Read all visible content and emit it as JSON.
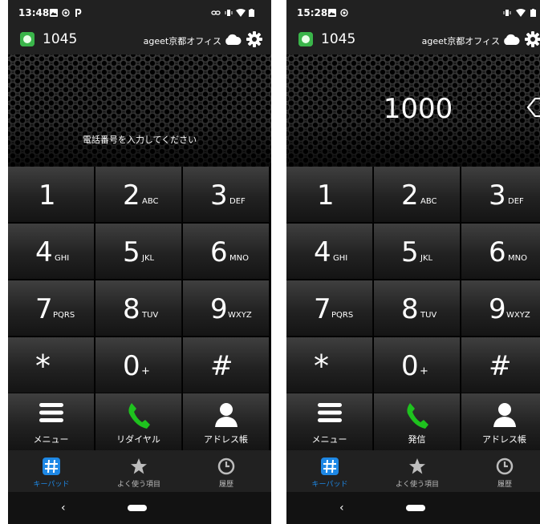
{
  "colors": {
    "status_online": "#3ab54a",
    "tab_active": "#1e88e5",
    "call_green": "#1ec21e",
    "background": "#000000"
  },
  "screens": [
    {
      "status_time": "13:48",
      "extension": "1045",
      "office": "ageet京都オフィス",
      "display_hint": "電話番号を入力してください",
      "entered_number": "",
      "keys": [
        {
          "digit": "1",
          "letters": ""
        },
        {
          "digit": "2",
          "letters": "ABC"
        },
        {
          "digit": "3",
          "letters": "DEF"
        },
        {
          "digit": "4",
          "letters": "GHI"
        },
        {
          "digit": "5",
          "letters": "JKL"
        },
        {
          "digit": "6",
          "letters": "MNO"
        },
        {
          "digit": "7",
          "letters": "PQRS"
        },
        {
          "digit": "8",
          "letters": "TUV"
        },
        {
          "digit": "9",
          "letters": "WXYZ"
        },
        {
          "digit": "*",
          "letters": ""
        },
        {
          "digit": "0",
          "letters": "+"
        },
        {
          "digit": "#",
          "letters": ""
        }
      ],
      "actions": {
        "menu": "メニュー",
        "call": "リダイヤル",
        "address": "アドレス帳"
      },
      "tabs": {
        "keypad": "キーパッド",
        "favorites": "よく使う項目",
        "history": "履歴"
      },
      "nav_back": "‹"
    },
    {
      "status_time": "15:28",
      "extension": "1045",
      "office": "ageet京都オフィス",
      "display_hint": "",
      "entered_number": "1000",
      "keys": [
        {
          "digit": "1",
          "letters": ""
        },
        {
          "digit": "2",
          "letters": "ABC"
        },
        {
          "digit": "3",
          "letters": "DEF"
        },
        {
          "digit": "4",
          "letters": "GHI"
        },
        {
          "digit": "5",
          "letters": "JKL"
        },
        {
          "digit": "6",
          "letters": "MNO"
        },
        {
          "digit": "7",
          "letters": "PQRS"
        },
        {
          "digit": "8",
          "letters": "TUV"
        },
        {
          "digit": "9",
          "letters": "WXYZ"
        },
        {
          "digit": "*",
          "letters": ""
        },
        {
          "digit": "0",
          "letters": "+"
        },
        {
          "digit": "#",
          "letters": ""
        }
      ],
      "actions": {
        "menu": "メニュー",
        "call": "発信",
        "address": "アドレス帳"
      },
      "tabs": {
        "keypad": "キーパッド",
        "favorites": "よく使う項目",
        "history": "履歴"
      },
      "nav_back": "‹"
    }
  ]
}
